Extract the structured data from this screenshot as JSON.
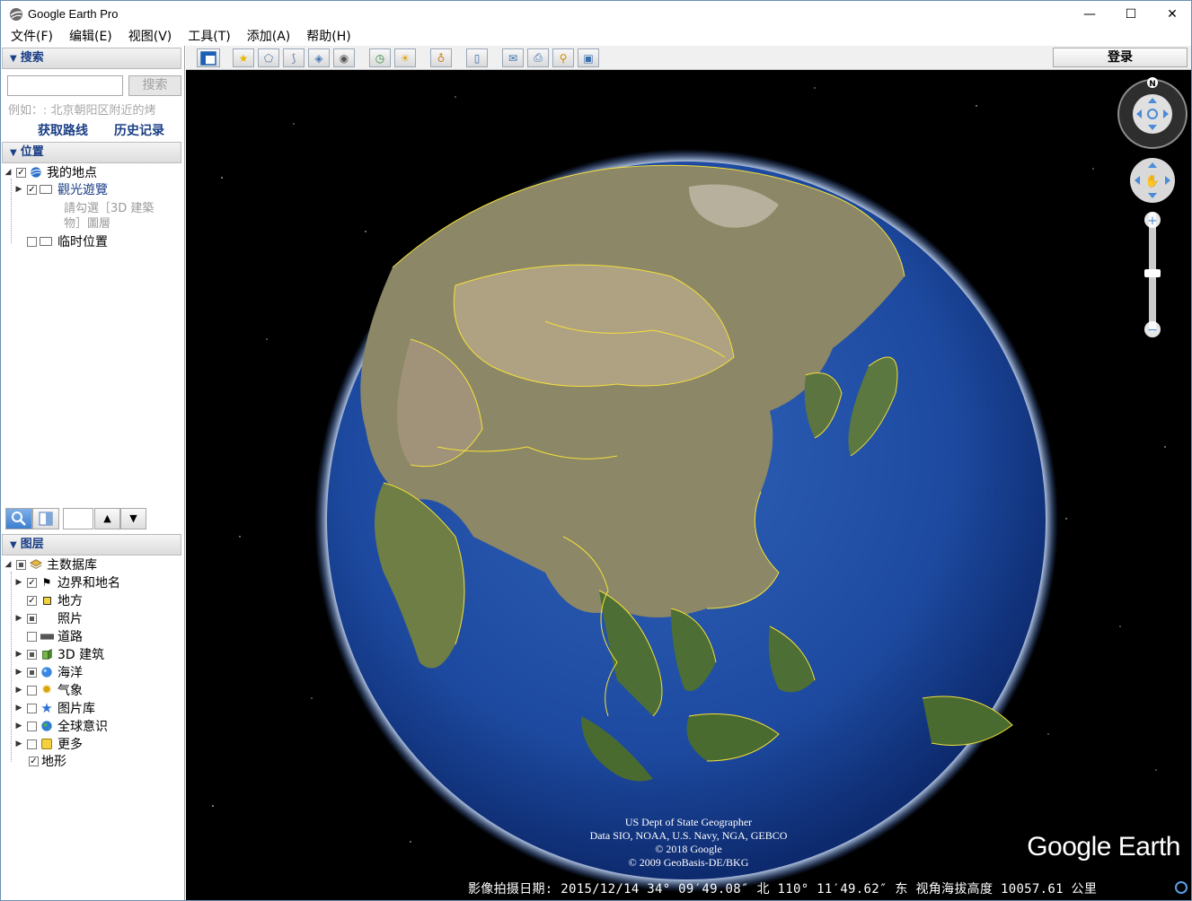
{
  "window": {
    "title": "Google Earth Pro",
    "minimize": "—",
    "maximize": "☐",
    "close": "✕"
  },
  "menu": [
    "文件(F)",
    "编辑(E)",
    "视图(V)",
    "工具(T)",
    "添加(A)",
    "帮助(H)"
  ],
  "search": {
    "header": "搜索",
    "button": "搜索",
    "placeholder": "",
    "hint": "例如：: 北京朝阳区附近的烤",
    "get_route": "获取路线",
    "history": "历史记录"
  },
  "places": {
    "header": "位置",
    "my_places": "我的地点",
    "sightseeing": "觀光遊覽",
    "sightseeing_hint_1": "請勾選［3D 建築",
    "sightseeing_hint_2": "物］圖層",
    "temp_places": "临时位置"
  },
  "layers": {
    "header": "图层",
    "primary_db": "主数据库",
    "items": [
      {
        "label": "边界和地名",
        "checked": true
      },
      {
        "label": "地方",
        "checked": true
      },
      {
        "label": "照片",
        "checked": "partial"
      },
      {
        "label": "道路",
        "checked": false
      },
      {
        "label": "3D 建筑",
        "checked": "partial"
      },
      {
        "label": "海洋",
        "checked": "partial"
      },
      {
        "label": "气象",
        "checked": false
      },
      {
        "label": "图片库",
        "checked": false
      },
      {
        "label": "全球意识",
        "checked": false
      },
      {
        "label": "更多",
        "checked": false
      }
    ],
    "terrain": "地形"
  },
  "toolbar": {
    "login": "登录"
  },
  "viewport": {
    "attribution": [
      "US Dept of State Geographer",
      "Data SIO, NOAA, U.S. Navy, NGA, GEBCO",
      "© 2018 Google",
      "© 2009 GeoBasis-DE/BKG"
    ],
    "logo": "Google Earth",
    "status": "影像拍摄日期: 2015/12/14   34° 09′49.08″ 北 110° 11′49.62″ 东  视角海拔高度 10057.61 公里",
    "compass_north": "N"
  },
  "colors": {
    "accent": "#1b3f86",
    "space": "#000000",
    "ocean": "#1f4fa8",
    "border_lines": "#f4e03a"
  }
}
